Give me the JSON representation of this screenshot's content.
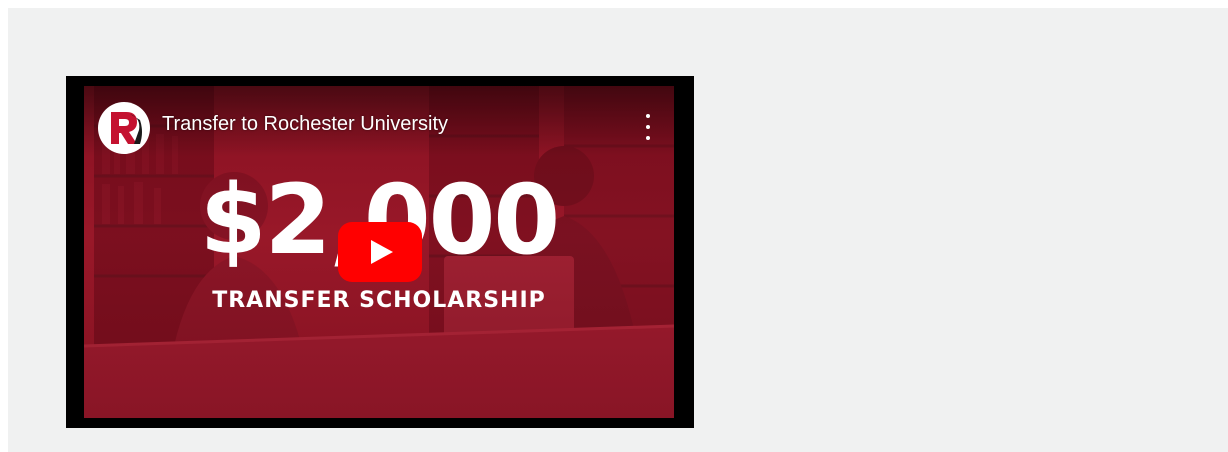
{
  "video": {
    "title": "Transfer to Rochester University",
    "channel_logo_icon": "rochester-university-logo-icon",
    "menu_icon": "more-vertical-icon",
    "play_icon": "youtube-play-icon",
    "thumbnail": {
      "amount": "$2,000",
      "caption": "TRANSFER SCHOLARSHIP"
    },
    "colors": {
      "brand_red": "#c41230",
      "play_red": "#ff0000",
      "panel_bg": "#f0f1f1"
    }
  }
}
